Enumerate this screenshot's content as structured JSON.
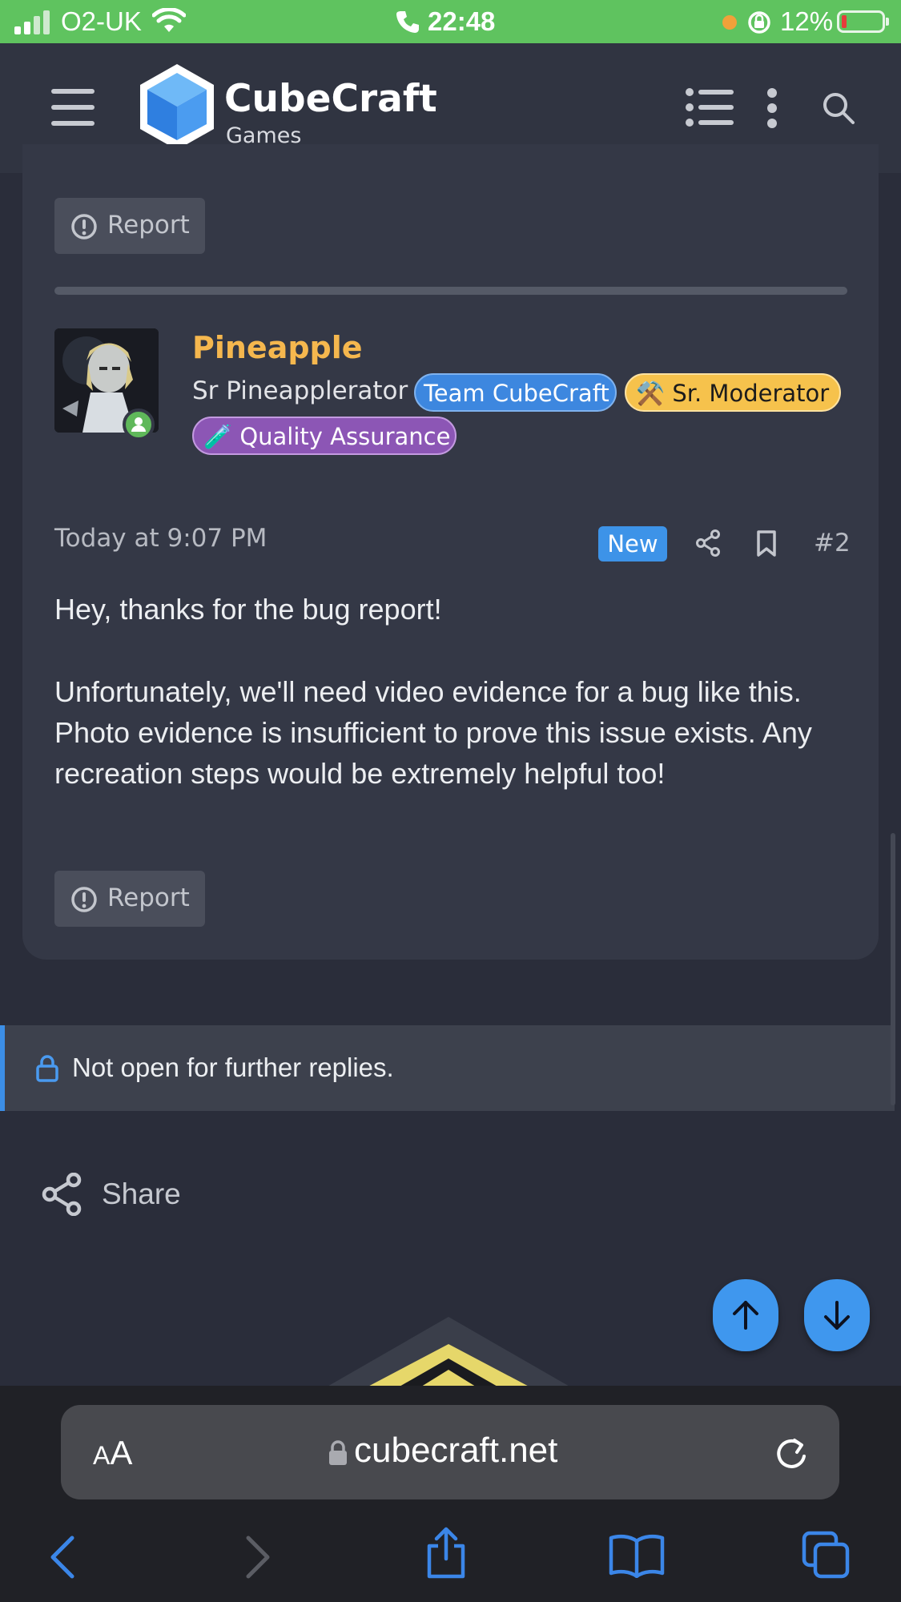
{
  "status_bar": {
    "carrier": "O2-UK",
    "time": "22:48",
    "battery_percent": "12%",
    "battery_level": 0.12,
    "background_color": "#5fc35f"
  },
  "header": {
    "logo_title": "CubeCraft",
    "logo_subtitle": "Games",
    "menu_icon": "hamburger-icon",
    "list_icon": "list-icon",
    "more_icon": "vertical-dots-icon",
    "search_icon": "search-icon"
  },
  "previous_post": {
    "report_label": "Report"
  },
  "post": {
    "author": "Pineapple",
    "user_title": "Sr Pineapplerator",
    "badges": [
      {
        "label": "Team CubeCraft",
        "color": "#3d87df"
      },
      {
        "label": "Sr. Moderator",
        "icon": "⚒️",
        "color": "#f6c24c"
      },
      {
        "label": "Quality Assurance",
        "icon": "🧪",
        "color": "#8c56b5"
      }
    ],
    "date": "Today at 9:07 PM",
    "new_label": "New",
    "post_number": "#2",
    "body_paragraph_1": "Hey, thanks for the bug report!",
    "body_paragraph_2": "Unfortunately, we'll need video evidence for a bug like this. Photo evidence is insufficient to prove this issue exists. Any recreation steps would be extremely helpful too!",
    "report_label": "Report"
  },
  "thread_status": {
    "locked_text": "Not open for further replies."
  },
  "share": {
    "label": "Share"
  },
  "browser": {
    "text_size_label": "AA",
    "url": "cubecraft.net"
  },
  "colors": {
    "accent": "#3f97ee",
    "username": "#f5b74e",
    "card_bg": "#343846",
    "page_bg": "#2a2d3a"
  }
}
